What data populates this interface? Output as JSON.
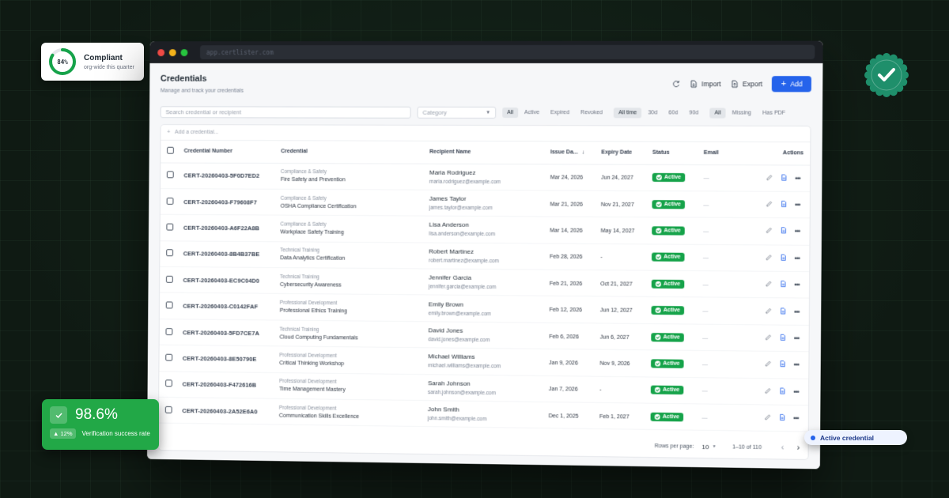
{
  "browser": {
    "url": "app.certlister.com"
  },
  "page": {
    "title": "Credentials",
    "subtitle": "Manage and track your credentials"
  },
  "toolbar": {
    "refresh_icon": "refresh-icon",
    "import_label": "Import",
    "export_label": "Export",
    "add_label": "Add"
  },
  "filters": {
    "search_placeholder": "Search credential or recipient",
    "category_placeholder": "Category",
    "status": [
      "All",
      "Active",
      "Expired",
      "Revoked"
    ],
    "status_selected": "All",
    "range": [
      "All time",
      "30d",
      "60d",
      "90d"
    ],
    "range_selected": "All time",
    "pdf": [
      "All",
      "Missing",
      "Has PDF"
    ],
    "pdf_selected": "All"
  },
  "table": {
    "add_placeholder": "Add a credential...",
    "columns": [
      "Credential Number",
      "Credential",
      "Recipient Name",
      "Issue Da...",
      "Expiry Date",
      "Status",
      "Email",
      "Actions"
    ],
    "rows": [
      {
        "number": "CERT-20260403-5F0D7ED2",
        "category": "Compliance & Safety",
        "credential": "Fire Safety and Prevention",
        "name": "Maria Rodriguez",
        "email": "maria.rodriguez@example.com",
        "issue": "Mar 24, 2026",
        "expiry": "Jun 24, 2027",
        "status": "Active",
        "email_col": "—"
      },
      {
        "number": "CERT-20260403-F79608F7",
        "category": "Compliance & Safety",
        "credential": "OSHA Compliance Certification",
        "name": "James Taylor",
        "email": "james.taylor@example.com",
        "issue": "Mar 21, 2026",
        "expiry": "Nov 21, 2027",
        "status": "Active",
        "email_col": "—"
      },
      {
        "number": "CERT-20260403-A6F22A8B",
        "category": "Compliance & Safety",
        "credential": "Workplace Safety Training",
        "name": "Lisa Anderson",
        "email": "lisa.anderson@example.com",
        "issue": "Mar 14, 2026",
        "expiry": "May 14, 2027",
        "status": "Active",
        "email_col": "—"
      },
      {
        "number": "CERT-20260403-8B4B37BE",
        "category": "Technical Training",
        "credential": "Data Analytics Certification",
        "name": "Robert Martinez",
        "email": "robert.martinez@example.com",
        "issue": "Feb 28, 2026",
        "expiry": "-",
        "status": "Active",
        "email_col": "—"
      },
      {
        "number": "CERT-20260403-EC9C04D0",
        "category": "Technical Training",
        "credential": "Cybersecurity Awareness",
        "name": "Jennifer Garcia",
        "email": "jennifer.garcia@example.com",
        "issue": "Feb 21, 2026",
        "expiry": "Oct 21, 2027",
        "status": "Active",
        "email_col": "—"
      },
      {
        "number": "CERT-20260403-C0142FAF",
        "category": "Professional Development",
        "credential": "Professional Ethics Training",
        "name": "Emily Brown",
        "email": "emily.brown@example.com",
        "issue": "Feb 12, 2026",
        "expiry": "Jun 12, 2027",
        "status": "Active",
        "email_col": "—"
      },
      {
        "number": "CERT-20260403-5FD7CE7A",
        "category": "Technical Training",
        "credential": "Cloud Computing Fundamentals",
        "name": "David Jones",
        "email": "david.jones@example.com",
        "issue": "Feb 6, 2026",
        "expiry": "Jun 6, 2027",
        "status": "Active",
        "email_col": "—"
      },
      {
        "number": "CERT-20260403-8E50790E",
        "category": "Professional Development",
        "credential": "Critical Thinking Workshop",
        "name": "Michael Williams",
        "email": "michael.williams@example.com",
        "issue": "Jan 9, 2026",
        "expiry": "Nov 9, 2026",
        "status": "Active",
        "email_col": "—"
      },
      {
        "number": "CERT-20260403-F472616B",
        "category": "Professional Development",
        "credential": "Time Management Mastery",
        "name": "Sarah Johnson",
        "email": "sarah.johnson@example.com",
        "issue": "Jan 7, 2026",
        "expiry": "-",
        "status": "Active",
        "email_col": "—"
      },
      {
        "number": "CERT-20260403-2A52E6A0",
        "category": "Professional Development",
        "credential": "Communication Skills Excellence",
        "name": "John Smith",
        "email": "john.smith@example.com",
        "issue": "Dec 1, 2025",
        "expiry": "Feb 1, 2027",
        "status": "Active",
        "email_col": "—"
      }
    ]
  },
  "pagination": {
    "rows_label": "Rows per page:",
    "rows_value": "10",
    "range": "1–10 of 110"
  },
  "compliance": {
    "percent": "84%",
    "value": 0.84,
    "title": "Compliant",
    "subtitle": "org-wide this quarter"
  },
  "verification": {
    "value": "98.6%",
    "delta": "▲ 12%",
    "label": "Verification success rate"
  },
  "legend_pill": {
    "label": "Active credential"
  },
  "colors": {
    "accent": "#2563eb",
    "success": "#16a34a",
    "card_green": "#22a847",
    "seal": "#1f8f6b"
  }
}
